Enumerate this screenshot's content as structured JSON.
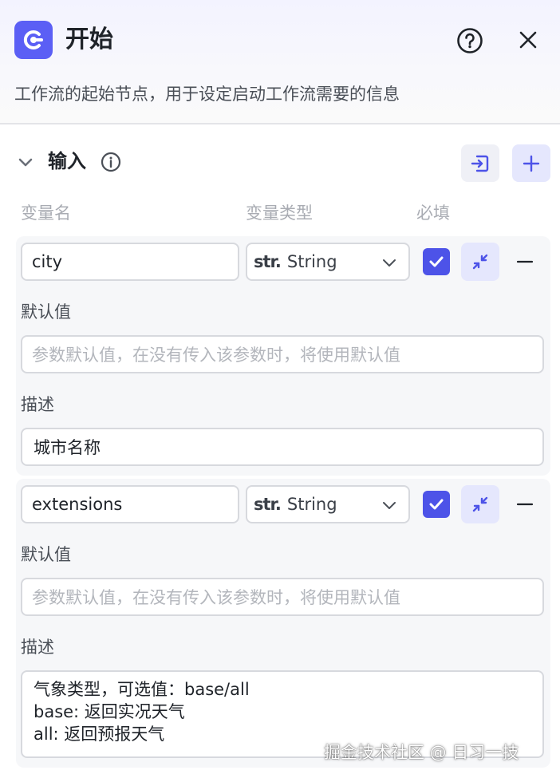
{
  "header": {
    "title": "开始",
    "description": "工作流的起始节点，用于设定启动工作流需要的信息"
  },
  "section": {
    "title": "输入"
  },
  "columns": {
    "name": "变量名",
    "type": "变量类型",
    "required": "必填"
  },
  "variables": [
    {
      "name": "city",
      "type_prefix": "str.",
      "type": "String",
      "required": true,
      "default_label": "默认值",
      "default_placeholder": "参数默认值，在没有传入该参数时，将使用默认值",
      "desc_label": "描述",
      "description": "城市名称"
    },
    {
      "name": "extensions",
      "type_prefix": "str.",
      "type": "String",
      "required": true,
      "default_label": "默认值",
      "default_placeholder": "参数默认值，在没有传入该参数时，将使用默认值",
      "desc_label": "描述",
      "description": "气象类型，可选值：base/all\nbase: 返回实况天气\nall: 返回预报天气"
    }
  ],
  "watermark": "掘金技术社区 @ 日习一技",
  "colors": {
    "accent": "#4d53e8",
    "accent_light": "#e5e7fd"
  }
}
